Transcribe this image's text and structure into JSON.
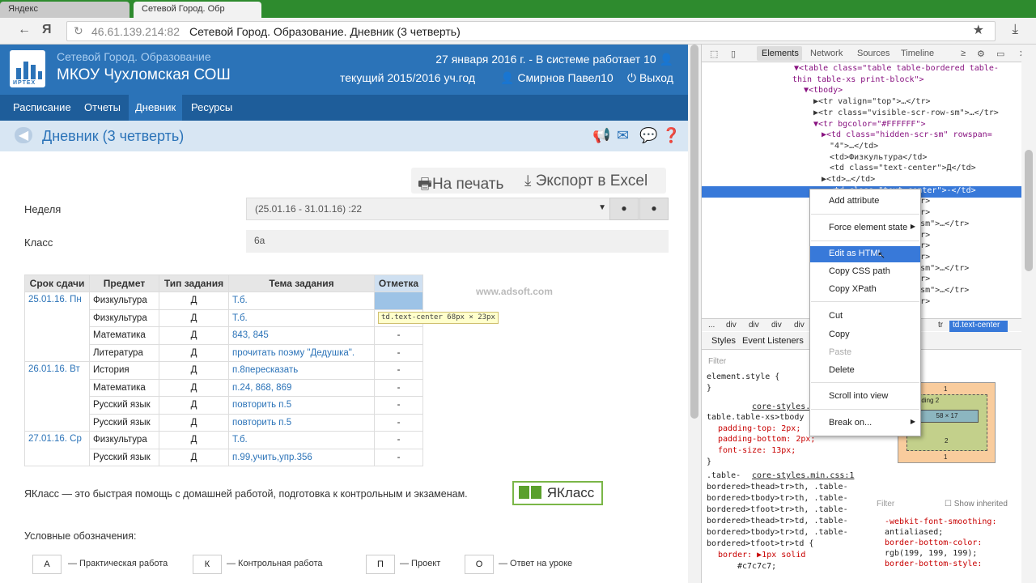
{
  "browser": {
    "tab1": "Яндекс",
    "tab2": "Сетевой Город. Обр",
    "host": "46.61.139.214:82",
    "title": "Сетевой Город. Образование. Дневник (3 четверть)",
    "yandex": "Я"
  },
  "header": {
    "org": "Сетевой Город. Образование",
    "school": "МКОУ Чухломская СОШ",
    "date": "27 января 2016 г. - В системе работает 10",
    "year": "текущий 2015/2016 уч.год",
    "user": "Смирнов Павел10",
    "exit": "Выход",
    "logo_text": "ИРТЕХ"
  },
  "menu": [
    "Расписание",
    "Отчеты",
    "Дневник",
    "Ресурсы"
  ],
  "page": {
    "title": "Дневник (3 четверть)",
    "print": "На печать",
    "export": "Экспорт в Excel",
    "week_label": "Неделя",
    "week_value": "(25.01.16 - 31.01.16) :22",
    "class_label": "Класс",
    "class_value": "6а"
  },
  "table": {
    "headers": [
      "Срок сдачи",
      "Предмет",
      "Тип задания",
      "Тема задания",
      "Отметка"
    ],
    "rows": [
      {
        "date": "25.01.16. Пн",
        "subj": "Физкультура",
        "type": "Д",
        "topic": "Т.б.",
        "mark": ""
      },
      {
        "date": "",
        "subj": "Физкультура",
        "type": "Д",
        "topic": "Т.б.",
        "mark": "-"
      },
      {
        "date": "",
        "subj": "Математика",
        "type": "Д",
        "topic": "843, 845",
        "mark": "-"
      },
      {
        "date": "",
        "subj": "Литература",
        "type": "Д",
        "topic": "прочитать поэму \"Дедушка\".",
        "mark": "-"
      },
      {
        "date": "26.01.16. Вт",
        "subj": "История",
        "type": "Д",
        "topic": "п.8пересказать",
        "mark": "-"
      },
      {
        "date": "",
        "subj": "Математика",
        "type": "Д",
        "topic": "п.24, 868, 869",
        "mark": "-"
      },
      {
        "date": "",
        "subj": "Русский язык",
        "type": "Д",
        "topic": "повторить п.5",
        "mark": "-"
      },
      {
        "date": "",
        "subj": "Русский язык",
        "type": "Д",
        "topic": "повторить п.5",
        "mark": "-"
      },
      {
        "date": "27.01.16. Ср",
        "subj": "Физкультура",
        "type": "Д",
        "topic": "Т.б.",
        "mark": "-"
      },
      {
        "date": "",
        "subj": "Русский язык",
        "type": "Д",
        "topic": "п.99,учить,упр.356",
        "mark": "-"
      }
    ]
  },
  "tooltip": "td.text-center 68px × 23px",
  "watermark": "www.adsoft.com",
  "yaklass": {
    "text": "ЯКласс — это быстрая помощь с домашней работой, подготовка к контрольным и экзаменам.",
    "btn": "ЯКласс"
  },
  "legend": {
    "title": "Условные обозначения:",
    "items": [
      {
        "k": "А",
        "v": "— Практическая работа"
      },
      {
        "k": "К",
        "v": "— Контрольная работа"
      },
      {
        "k": "П",
        "v": "— Проект"
      },
      {
        "k": "О",
        "v": "— Ответ на уроке"
      }
    ]
  },
  "devtools": {
    "tabs": [
      "Elements",
      "Network",
      "Sources",
      "Timeline"
    ],
    "dom": [
      "▼<table class=\"table table-bordered table-",
      "thin table-xs print-block\">",
      "▼<tbody>",
      "▶<tr valign=\"top\">…</tr>",
      "▶<tr class=\"visible-scr-row-sm\">…</tr>",
      "▼<tr bgcolor=\"#FFFFFF\">",
      "▶<td class=\"hidden-scr-sm\" rowspan=",
      "\"4\">…</td>",
      "<td>Физкультура</td>",
      "<td class=\"text-center\">Д</td>",
      "▶<td>…</td>",
      "<td class=\"text-center\">-</td>",
      "…</tr>",
      "…</tr>",
      "row-sm\">…</tr>",
      "…</tr>",
      "…</tr>",
      "…</tr>",
      "row-sm\">…</tr>",
      "…</tr>",
      "row-sm\">…</tr>",
      "…</tr>"
    ],
    "crumbs": [
      "...",
      "div",
      "div",
      "div",
      "div",
      "tr",
      "td.text-center"
    ],
    "styles_tabs": [
      "Styles",
      "Event Listeners"
    ],
    "filter": "Filter",
    "css": [
      "element.style {",
      "}",
      "core-styles.",
      "table.table-xs>tbody",
      "padding-top: 2px;",
      "padding-bottom: 2px;",
      "font-size: 13px;",
      "}",
      ".table-",
      "core-styles.min.css:1",
      "bordered>thead>tr>th, .table-",
      "bordered>tbody>tr>th, .table-",
      "bordered>tfoot>tr>th, .table-",
      "bordered>thead>tr>td, .table-",
      "bordered>tbody>tr>td, .table-",
      "bordered>tfoot>tr>td {",
      "border: ▶1px solid",
      "#c7c7c7;"
    ],
    "box": {
      "margin": "1",
      "padding": "2",
      "content": "58 × 17",
      "p_bottom": "2",
      "m_bottom": "1"
    },
    "show_inherited": "Show inherited",
    "computed": [
      "-webkit-font-smoothing:",
      "antialiased;",
      "border-bottom-color:",
      "rgb(199, 199, 199);",
      "border-bottom-style:"
    ]
  },
  "context_menu": [
    "Add attribute",
    "Force element state",
    "Edit as HTML",
    "Copy CSS path",
    "Copy XPath",
    "Cut",
    "Copy",
    "Paste",
    "Delete",
    "Scroll into view",
    "Break on..."
  ]
}
